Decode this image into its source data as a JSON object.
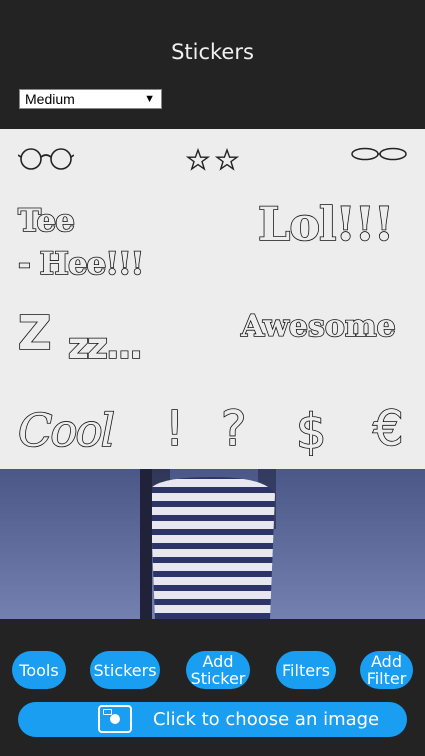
{
  "panel": {
    "title": "Stickers",
    "size_select": {
      "value": "Medium"
    }
  },
  "stickers": {
    "tee": "Tee",
    "heee": "- Hee!!!",
    "lol": "Lol!!!",
    "z1": "Z",
    "zzz": "zz...",
    "awesome": "Awesome",
    "cool": "Cool",
    "exclaim": "!",
    "question": "?",
    "dollar": "$",
    "euro": "€"
  },
  "toolbar": {
    "tools": "Tools",
    "stickers": "Stickers",
    "add_sticker_1": "Add",
    "add_sticker_2": "Sticker",
    "filters": "Filters",
    "add_filter_1": "Add",
    "add_filter_2": "Filter"
  },
  "choose_image": {
    "label": "Click to choose an image"
  },
  "colors": {
    "accent": "#1a9ef2",
    "panel_bg": "#232323",
    "sticker_bg": "#ededed"
  }
}
